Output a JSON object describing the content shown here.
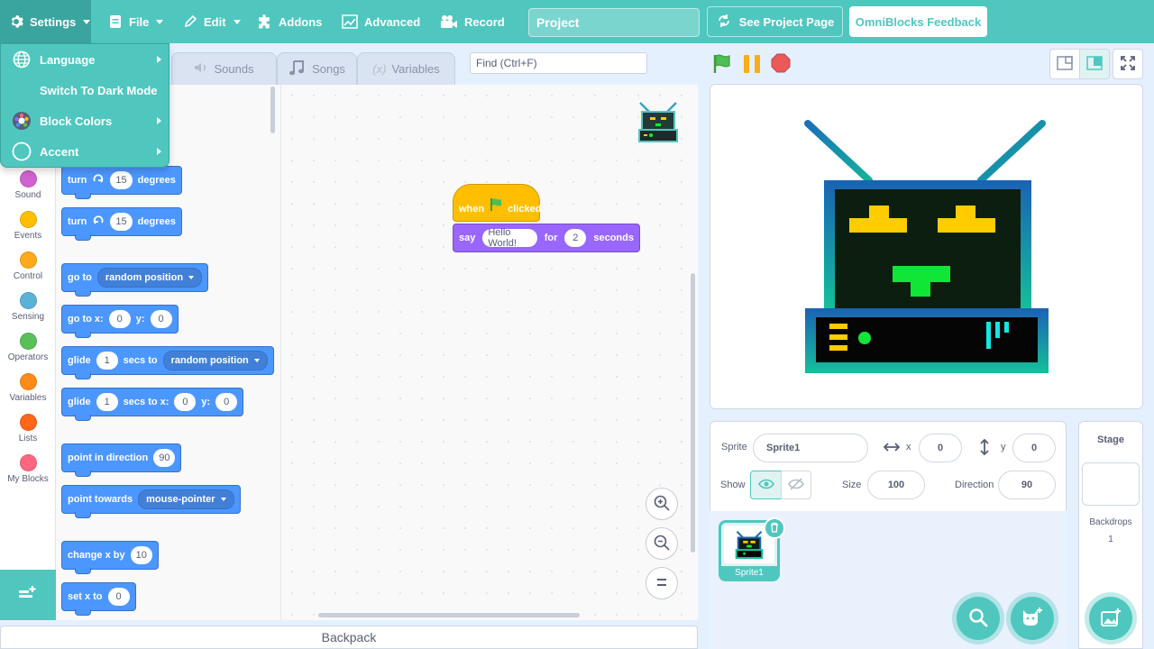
{
  "menubar": {
    "settings": "Settings",
    "file": "File",
    "edit": "Edit",
    "addons": "Addons",
    "advanced": "Advanced",
    "record": "Record",
    "project_title": "Project",
    "see_project_page": "See Project Page",
    "feedback": "OmniBlocks Feedback"
  },
  "settings_menu": {
    "language": "Language",
    "dark_mode": "Switch To Dark Mode",
    "block_colors": "Block Colors",
    "accent": "Accent"
  },
  "tabs": {
    "sounds": "Sounds",
    "songs": "Songs",
    "variables": "Variables"
  },
  "find_placeholder": "Find (Ctrl+F)",
  "categories": [
    {
      "label": "Sound",
      "color": "#cf63cf"
    },
    {
      "label": "Events",
      "color": "#ffbf00"
    },
    {
      "label": "Control",
      "color": "#ffab19"
    },
    {
      "label": "Sensing",
      "color": "#5cb1d6"
    },
    {
      "label": "Operators",
      "color": "#59c059"
    },
    {
      "label": "Variables",
      "color": "#ff8c1a"
    },
    {
      "label": "Lists",
      "color": "#ff661a"
    },
    {
      "label": "My Blocks",
      "color": "#ff6680"
    }
  ],
  "palette": {
    "turn_right": {
      "a": "turn",
      "n": "15",
      "b": "degrees"
    },
    "turn_left": {
      "a": "turn",
      "n": "15",
      "b": "degrees"
    },
    "go_to": {
      "a": "go to",
      "opt": "random position"
    },
    "go_to_xy": {
      "a": "go to x:",
      "x": "0",
      "b": "y:",
      "y": "0"
    },
    "glide_to": {
      "a": "glide",
      "n": "1",
      "b": "secs to",
      "opt": "random position"
    },
    "glide_xy": {
      "a": "glide",
      "n": "1",
      "b": "secs to x:",
      "x": "0",
      "c": "y:",
      "y": "0"
    },
    "point_dir": {
      "a": "point in direction",
      "n": "90"
    },
    "point_towards": {
      "a": "point towards",
      "opt": "mouse-pointer"
    },
    "change_x": {
      "a": "change x by",
      "n": "10"
    },
    "set_x": {
      "a": "set x to",
      "n": "0"
    }
  },
  "script": {
    "hat_when": "when",
    "hat_clicked": "clicked",
    "say": "say",
    "message": "Hello World!",
    "for": "for",
    "secs": "2",
    "seconds": "seconds"
  },
  "backpack": "Backpack",
  "sprite_info": {
    "sprite_label": "Sprite",
    "sprite_name": "Sprite1",
    "x_label": "x",
    "x": "0",
    "y_label": "y",
    "y": "0",
    "show_label": "Show",
    "size_label": "Size",
    "size": "100",
    "direction_label": "Direction",
    "direction": "90"
  },
  "sprites": [
    {
      "name": "Sprite1"
    }
  ],
  "stage_pane": {
    "title": "Stage",
    "backdrops_label": "Backdrops",
    "backdrops_count": "1"
  },
  "colors": {
    "accent": "#4fc7bf",
    "motion": "#4c97ff",
    "events": "#ffbf00",
    "looks": "#9966ff"
  }
}
